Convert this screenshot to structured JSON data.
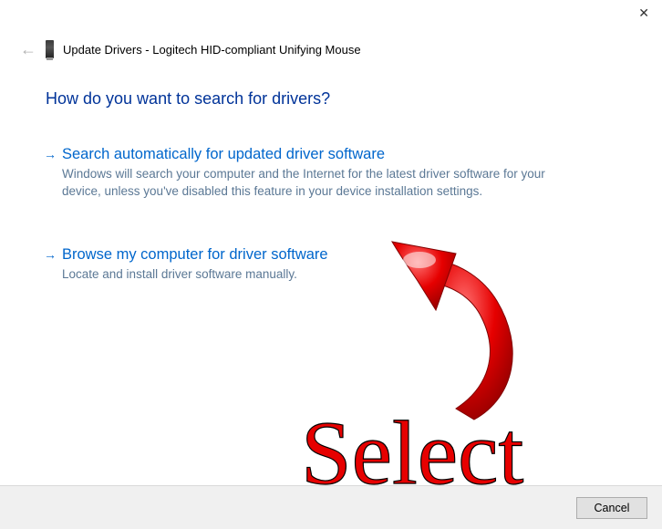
{
  "header": {
    "title": "Update Drivers - Logitech HID-compliant Unifying Mouse"
  },
  "main": {
    "heading": "How do you want to search for drivers?",
    "options": [
      {
        "title": "Search automatically for updated driver software",
        "desc": "Windows will search your computer and the Internet for the latest driver software for your device, unless you've disabled this feature in your device installation settings."
      },
      {
        "title": "Browse my computer for driver software",
        "desc": "Locate and install driver software manually."
      }
    ]
  },
  "footer": {
    "cancel_label": "Cancel"
  },
  "annotation": {
    "label": "Select"
  }
}
